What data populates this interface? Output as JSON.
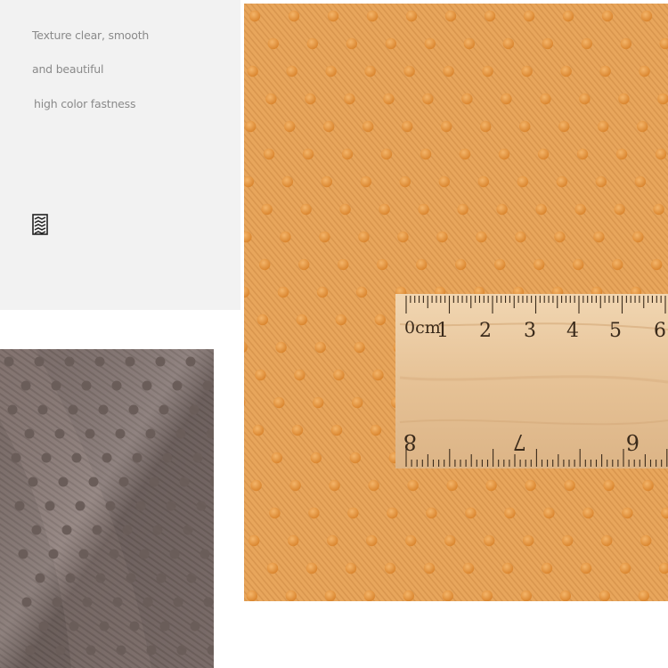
{
  "feature_text": {
    "line1": "Texture clear, smooth",
    "line2": "and beautiful",
    "line3": "high color fastness"
  },
  "icons": {
    "texture": "fabric-texture-icon"
  },
  "colors": {
    "panel_bg": "#f2f2f2",
    "text": "#8a8a8a",
    "orange_fabric": "#e8a65c",
    "orange_dot": "#e0892e",
    "brown_fabric": "#8a7a76",
    "brown_dot": "#6e605c",
    "ruler_wood": "#e9c8a0",
    "ruler_ink": "#3a2a1a"
  },
  "ruler": {
    "top_scale": [
      "0cm",
      "1",
      "2",
      "3",
      "4",
      "5",
      "6"
    ],
    "bottom_scale": [
      "8",
      "7",
      "6"
    ]
  }
}
